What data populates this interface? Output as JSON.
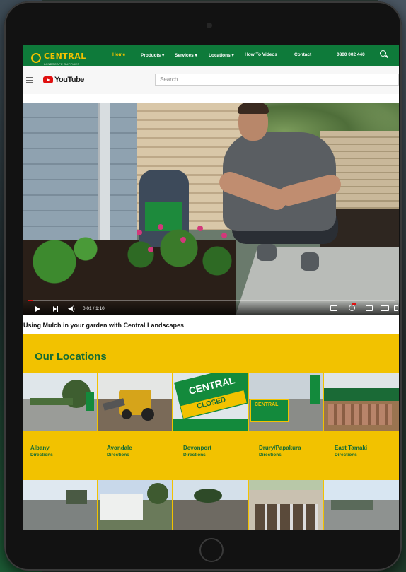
{
  "nav": {
    "logo_name": "CENTRAL",
    "logo_sub": "LANDSCAPE SUPPLIES",
    "links": [
      {
        "label": "Home",
        "active": true
      },
      {
        "label": "Products ▾",
        "active": false
      },
      {
        "label": "Services ▾",
        "active": false
      },
      {
        "label": "Locations ▾",
        "active": false
      },
      {
        "label": "How To Videos",
        "active": false
      },
      {
        "label": "Contact",
        "active": false
      }
    ],
    "phone": "0800 002 440",
    "search_icon": "search-icon"
  },
  "youtube": {
    "logo_text": "YouTube",
    "search_placeholder": "Search",
    "time": "0:01 / 1:10",
    "progress": 0.015,
    "video_title": "Using Mulch in your garden with Central Landscapes"
  },
  "locations": {
    "heading": "Our Locations",
    "closed_sign": "CLOSED",
    "sign_brand": "CENTRAL",
    "items": [
      {
        "name": "Albany",
        "link": "Directions"
      },
      {
        "name": "Avondale",
        "link": "Directions"
      },
      {
        "name": "Devonport",
        "link": "Directions"
      },
      {
        "name": "Drury/Papakura",
        "link": "Directions"
      },
      {
        "name": "East Tamaki",
        "link": "Directions"
      }
    ]
  },
  "colors": {
    "brand_green": "#0e7a3a",
    "brand_yellow": "#f2c200",
    "youtube_red": "#e01010"
  }
}
